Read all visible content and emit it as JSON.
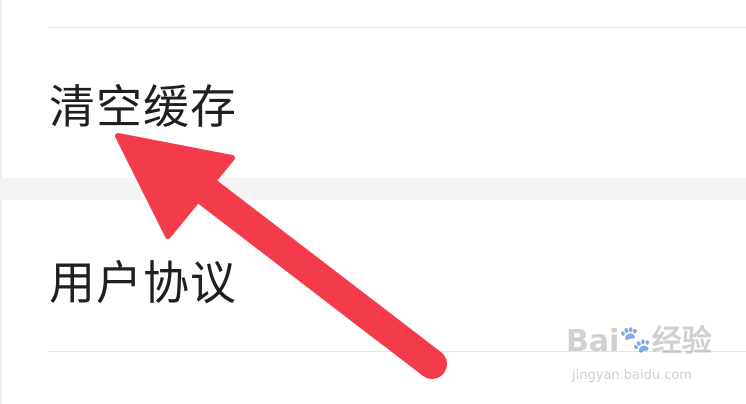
{
  "settings": {
    "items": [
      {
        "label": "清空缓存"
      },
      {
        "label": "用户协议"
      }
    ]
  },
  "annotation": {
    "arrow_color": "#f43b4b"
  },
  "watermark": {
    "brand": "Bai",
    "brand_suffix": "经验",
    "site": "jingyan.baidu.com"
  }
}
